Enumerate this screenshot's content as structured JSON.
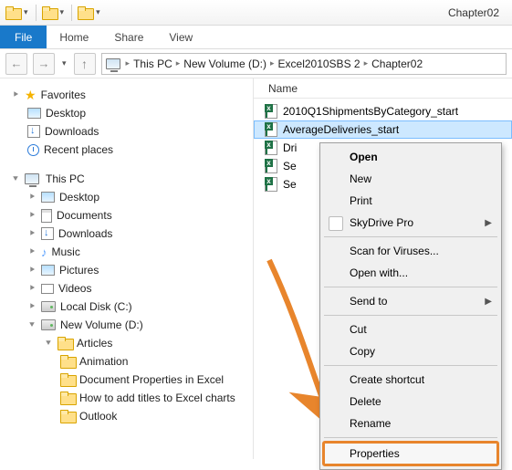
{
  "titlebar": {
    "window_title": "Chapter02"
  },
  "ribbon": {
    "file_label": "File",
    "tabs": [
      "Home",
      "Share",
      "View"
    ]
  },
  "breadcrumb": {
    "segments": [
      "This PC",
      "New Volume (D:)",
      "Excel2010SBS 2",
      "Chapter02"
    ]
  },
  "tree": {
    "favorites_label": "Favorites",
    "favorites": [
      "Desktop",
      "Downloads",
      "Recent places"
    ],
    "thispc_label": "This PC",
    "thispc_children": [
      "Desktop",
      "Documents",
      "Downloads",
      "Music",
      "Pictures",
      "Videos",
      "Local Disk (C:)",
      "New Volume (D:)"
    ],
    "articles_label": "Articles",
    "articles_children": [
      "Animation",
      "Document Properties in Excel",
      "How to add titles to Excel charts",
      "Outlook"
    ]
  },
  "list": {
    "header_name": "Name",
    "files": [
      "2010Q1ShipmentsByCategory_start",
      "AverageDeliveries_start",
      "Dri",
      "Se",
      "Se"
    ]
  },
  "context_menu": {
    "open": "Open",
    "new": "New",
    "print": "Print",
    "skydrive": "SkyDrive Pro",
    "scan": "Scan for Viruses...",
    "openwith": "Open with...",
    "sendto": "Send to",
    "cut": "Cut",
    "copy": "Copy",
    "shortcut": "Create shortcut",
    "delete": "Delete",
    "rename": "Rename",
    "properties": "Properties"
  }
}
